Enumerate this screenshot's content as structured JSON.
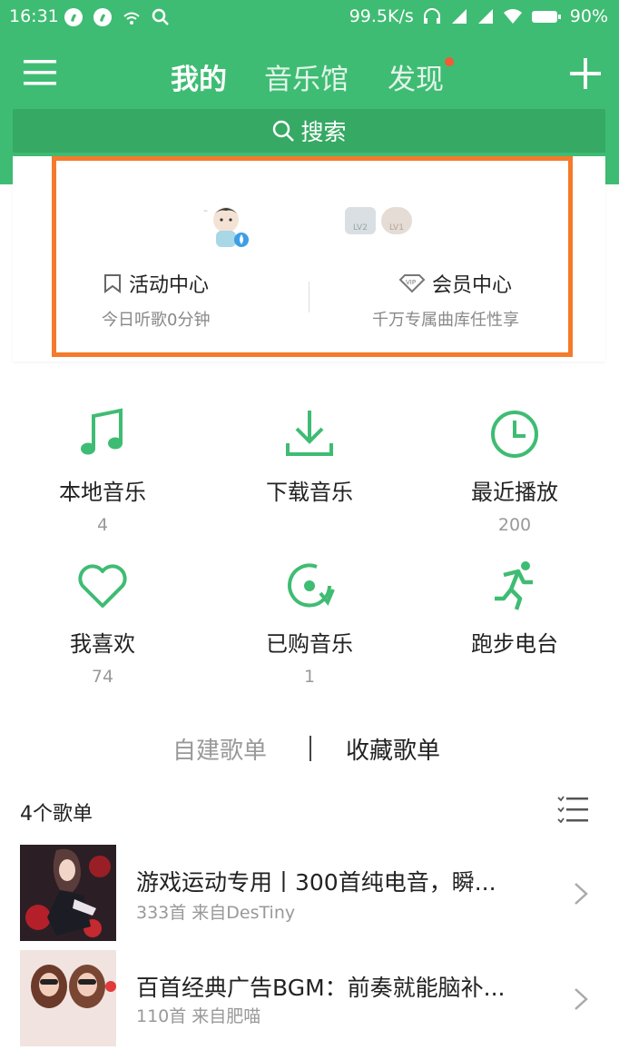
{
  "status_bar": {
    "time": "16:31",
    "speed": "99.5K/s",
    "battery": "90%"
  },
  "header": {
    "tabs": [
      {
        "label": "我的"
      },
      {
        "label": "音乐馆"
      },
      {
        "label": "发现"
      }
    ],
    "search_label": "搜索"
  },
  "profile": {
    "activity": {
      "title": "活动中心",
      "subtitle": "今日听歌0分钟"
    },
    "vip": {
      "title": "会员中心",
      "subtitle": "千万专属曲库任性享"
    },
    "level_badges": [
      "LV2",
      "LV1"
    ]
  },
  "grid": [
    {
      "label": "本地音乐",
      "count": "4",
      "icon": "music-note-icon"
    },
    {
      "label": "下载音乐",
      "count": "",
      "icon": "download-icon"
    },
    {
      "label": "最近播放",
      "count": "200",
      "icon": "clock-icon"
    },
    {
      "label": "我喜欢",
      "count": "74",
      "icon": "heart-icon"
    },
    {
      "label": "已购音乐",
      "count": "1",
      "icon": "purchased-disc-icon"
    },
    {
      "label": "跑步电台",
      "count": "",
      "icon": "running-icon"
    }
  ],
  "playlist_tabs": {
    "created": "自建歌单",
    "collected": "收藏歌单"
  },
  "playlist_count": "4个歌单",
  "playlists": [
    {
      "title": "游戏运动专用丨300首纯电音，瞬...",
      "subtitle": "333首 来自DesTiny"
    },
    {
      "title": "百首经典广告BGM：前奏就能脑补...",
      "subtitle": "110首 来自肥喵"
    }
  ],
  "colors": {
    "brand_green": "#3fbc73",
    "highlight_orange": "#f57a2b"
  }
}
